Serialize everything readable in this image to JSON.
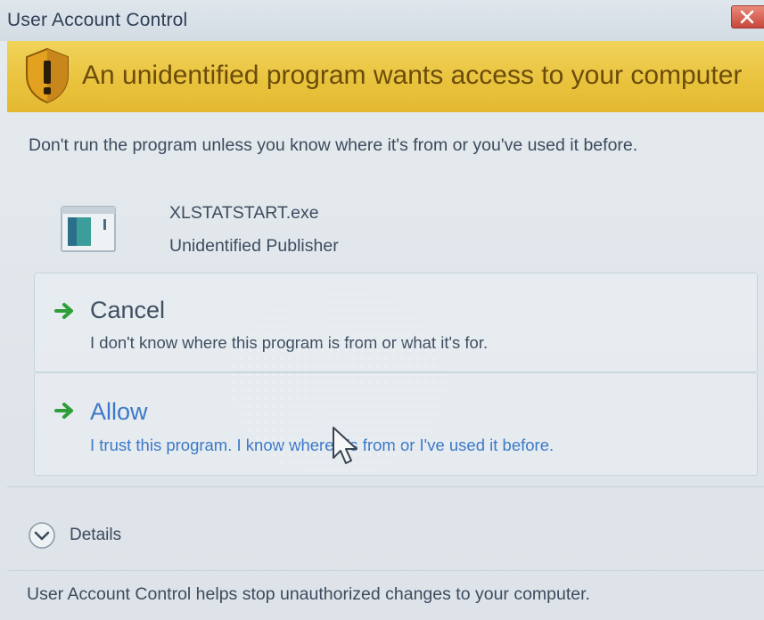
{
  "window": {
    "title": "User Account Control"
  },
  "banner": {
    "heading": "An unidentified program wants access to your computer",
    "icon": "shield-warning-icon"
  },
  "message": {
    "warning": "Don't run the program unless you know where it's from or you've used it before."
  },
  "program": {
    "name": "XLSTATSTART.exe",
    "publisher": "Unidentified Publisher",
    "icon": "application-icon"
  },
  "options": {
    "cancel": {
      "label": "Cancel",
      "description": "I don't know where this program is from or what it's for."
    },
    "allow": {
      "label": "Allow",
      "description": "I trust this program. I know where it's from or I've used it before."
    }
  },
  "details": {
    "label": "Details"
  },
  "footer": {
    "text": "User Account Control helps stop unauthorized changes to your computer."
  },
  "colors": {
    "banner": "#e9c23c",
    "accent_link": "#3b79c8",
    "arrow_green": "#2f9e3a"
  }
}
